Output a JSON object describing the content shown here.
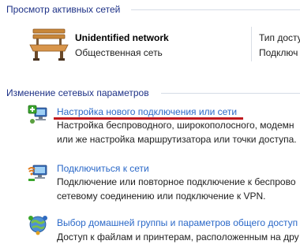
{
  "active_networks": {
    "heading": "Просмотр активных сетей",
    "network_name": "Unidentified network",
    "network_type": "Общественная сеть",
    "access_type_label": "Тип доступ",
    "connection_label": "Подключ"
  },
  "change_settings": {
    "heading": "Изменение сетевых параметров",
    "tasks": [
      {
        "link": "Настройка нового подключения или сети",
        "desc_lines": [
          "Настройка беспроводного, широкополосного, модемн",
          "или же настройка маршрутизатора или точки доступа."
        ],
        "icon": "new-connection-icon"
      },
      {
        "link": "Подключиться к сети",
        "desc_lines": [
          "Подключение или повторное подключение к беспрово",
          "сетевому соединению или подключение к VPN."
        ],
        "icon": "connect-network-icon"
      },
      {
        "link": "Выбор домашней группы и параметров общего доступ",
        "desc_lines": [
          "Доступ к файлам и принтерам, расположенным на дру"
        ],
        "icon": "homegroup-icon"
      }
    ]
  },
  "colors": {
    "heading": "#1e3287",
    "link": "#2a68c8",
    "highlight_underline": "#c0181e"
  }
}
